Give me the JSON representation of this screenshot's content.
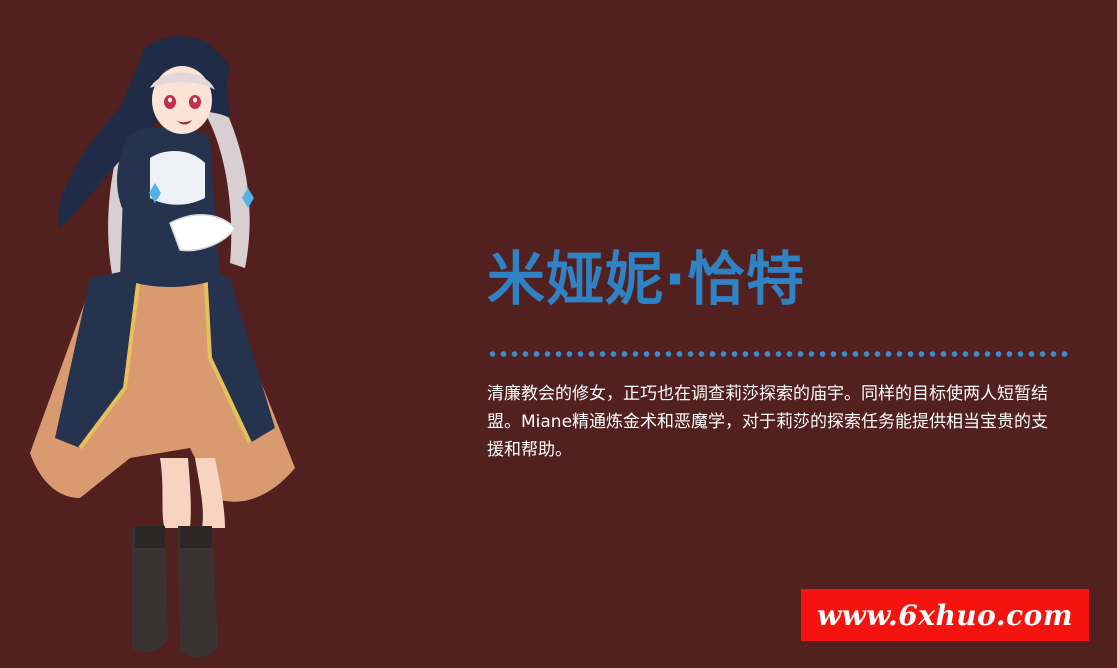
{
  "character": {
    "name": "米娅妮·恰特",
    "description": "清廉教会的修女，正巧也在调查莉莎探索的庙宇。同样的目标使两人短暂结盟。Miane精通炼金术和恶魔学，对于莉莎的探索任务能提供相当宝贵的支援和帮助。"
  },
  "watermark": {
    "text": "www.6xhuo.com"
  },
  "colors": {
    "background": "#51201f",
    "name": "#2f82c4",
    "divider": "#3a8fd0",
    "watermark_bg": "#f5130f"
  }
}
